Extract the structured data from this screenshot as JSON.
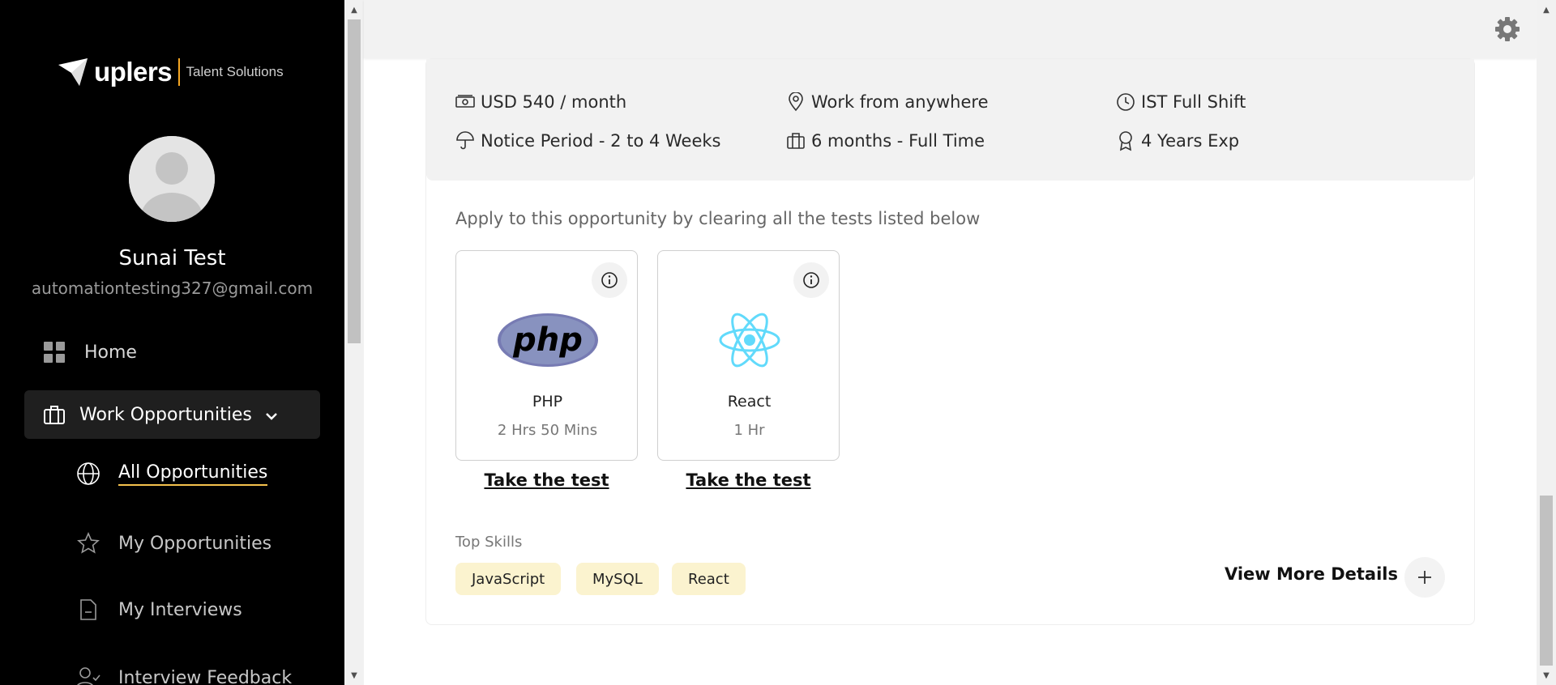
{
  "brand": {
    "name": "uplers",
    "tagline": "Talent Solutions"
  },
  "user": {
    "name": "Sunai Test",
    "email": "automationtesting327@gmail.com"
  },
  "nav": {
    "home": "Home",
    "work_opportunities": "Work Opportunities",
    "all_opportunities": "All Opportunities",
    "my_opportunities": "My Opportunities",
    "my_interviews": "My Interviews",
    "interview_feedback": "Interview Feedback"
  },
  "job_info": {
    "salary": "USD 540 / month",
    "location": "Work from anywhere",
    "shift": "IST Full Shift",
    "notice": "Notice Period - 2 to 4 Weeks",
    "duration": "6 months - Full Time",
    "experience": "4 Years Exp"
  },
  "apply_text": "Apply to this opportunity by clearing all the tests listed below",
  "tests": [
    {
      "name": "PHP",
      "duration": "2 Hrs 50 Mins",
      "action": "Take the test",
      "logo_text": "php"
    },
    {
      "name": "React",
      "duration": "1 Hr",
      "action": "Take the test"
    }
  ],
  "skills": {
    "title": "Top Skills",
    "items": [
      "JavaScript",
      "MySQL",
      "React"
    ]
  },
  "view_more": "View More Details",
  "colors": {
    "accent": "#f5c24d",
    "chip_bg": "#fbf3cf",
    "sidebar_bg": "#000000",
    "react": "#61dafb",
    "php": "#777bb3"
  }
}
